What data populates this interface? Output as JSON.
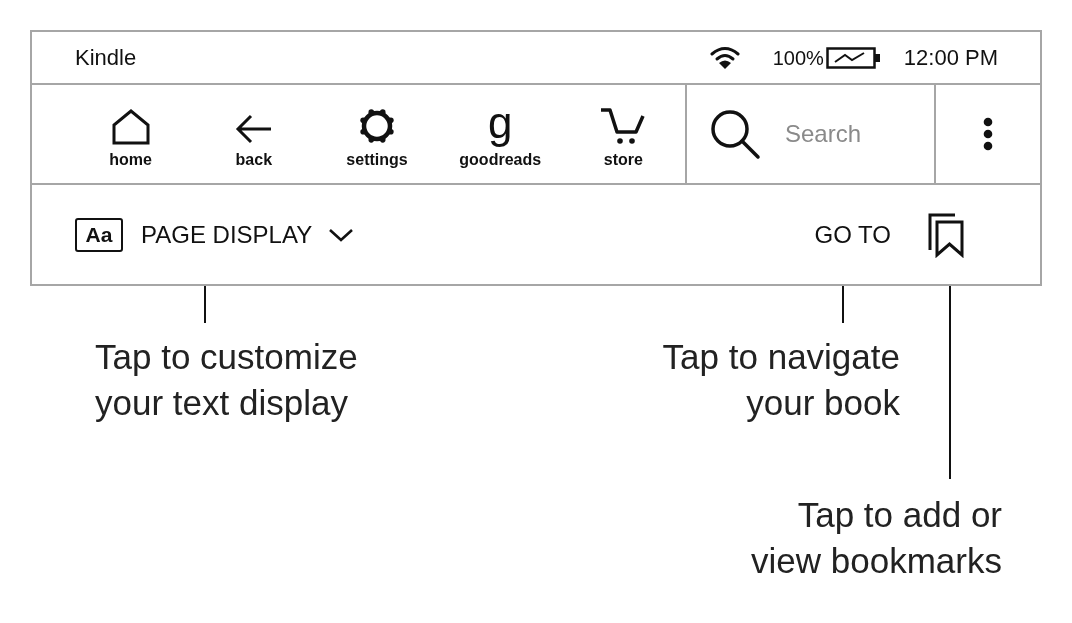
{
  "status_bar": {
    "title": "Kindle",
    "battery": "100%",
    "time": "12:00 PM"
  },
  "toolbar": {
    "items": [
      {
        "label": "home"
      },
      {
        "label": "back"
      },
      {
        "label": "settings"
      },
      {
        "label": "goodreads",
        "glyph": "g"
      },
      {
        "label": "store"
      }
    ],
    "search": {
      "placeholder": "Search"
    }
  },
  "reading_bar": {
    "font_button": "Aa",
    "page_display": "PAGE DISPLAY",
    "go_to": "GO TO"
  },
  "callouts": [
    {
      "lines": [
        "Tap to customize",
        "your text display"
      ]
    },
    {
      "lines": [
        "Tap to navigate",
        "your book"
      ]
    },
    {
      "lines": [
        "Tap to add or",
        "view bookmarks"
      ]
    }
  ]
}
